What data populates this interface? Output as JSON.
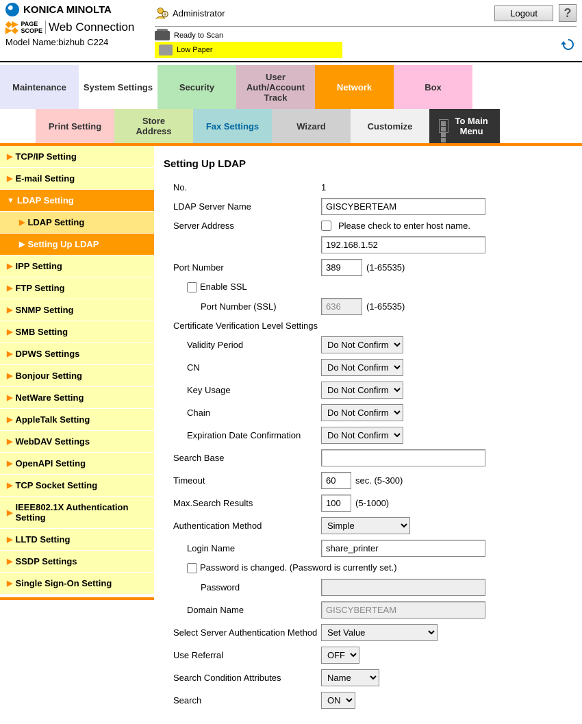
{
  "brand": "KONICA MINOLTA",
  "pagescope": {
    "small1": "PAGE",
    "small2": "SCOPE",
    "main": "Web Connection"
  },
  "model_label": "Model Name:",
  "model_value": "bizhub C224",
  "admin_user": "Administrator",
  "logout": "Logout",
  "help": "?",
  "status_ready": "Ready to Scan",
  "status_lowpaper": "Low Paper",
  "tabs1": {
    "maintenance": "Maintenance",
    "system": "System Settings",
    "security": "Security",
    "user": "User Auth/Account Track",
    "network": "Network",
    "box": "Box"
  },
  "tabs2": {
    "print": "Print Setting",
    "store": "Store Address",
    "fax": "Fax Settings",
    "wizard": "Wizard",
    "customize": "Customize",
    "tomain": "To Main Menu"
  },
  "sidebar": {
    "tcpip": "TCP/IP Setting",
    "email": "E-mail Setting",
    "ldap": "LDAP Setting",
    "ldap_sub1": "LDAP Setting",
    "ldap_sub2": "Setting Up LDAP",
    "ipp": "IPP Setting",
    "ftp": "FTP Setting",
    "snmp": "SNMP Setting",
    "smb": "SMB Setting",
    "dpws": "DPWS Settings",
    "bonjour": "Bonjour Setting",
    "netware": "NetWare Setting",
    "appletalk": "AppleTalk Setting",
    "webdav": "WebDAV Settings",
    "openapi": "OpenAPI Setting",
    "tcpsocket": "TCP Socket Setting",
    "ieee": "IEEE802.1X Authentication Setting",
    "lltd": "LLTD Setting",
    "ssdp": "SSDP Settings",
    "sso": "Single Sign-On Setting"
  },
  "page_title": "Setting Up LDAP",
  "form": {
    "no_label": "No.",
    "no_value": "1",
    "servername_label": "LDAP Server Name",
    "servername_value": "GISCYBERTEAM",
    "serveraddr_label": "Server Address",
    "serveraddr_check": "Please check to enter host name.",
    "serveraddr_value": "192.168.1.52",
    "port_label": "Port Number",
    "port_value": "389",
    "port_hint": "(1-65535)",
    "ssl_label": "Enable SSL",
    "sslport_label": "Port Number (SSL)",
    "sslport_value": "636",
    "sslport_hint": "(1-65535)",
    "certlevel_label": "Certificate Verification Level Settings",
    "validity_label": "Validity Period",
    "cn_label": "CN",
    "keyusage_label": "Key Usage",
    "chain_label": "Chain",
    "expdate_label": "Expiration Date Confirmation",
    "donotconfirm": "Do Not Confirm",
    "searchbase_label": "Search Base",
    "searchbase_value": "",
    "timeout_label": "Timeout",
    "timeout_value": "60",
    "timeout_hint": "sec. (5-300)",
    "maxresults_label": "Max.Search Results",
    "maxresults_value": "100",
    "maxresults_hint": "(5-1000)",
    "authmethod_label": "Authentication Method",
    "authmethod_value": "Simple",
    "loginname_label": "Login Name",
    "loginname_value": "share_printer",
    "pwchanged_label": "Password is changed.  (Password is currently set.)",
    "password_label": "Password",
    "domain_label": "Domain Name",
    "domain_value": "GISCYBERTEAM",
    "selectauth_label": "Select Server Authentication Method",
    "selectauth_value": "Set Value",
    "referral_label": "Use Referral",
    "referral_value": "OFF",
    "searchcond_label": "Search Condition Attributes",
    "searchcond_value": "Name",
    "search_label": "Search",
    "search_value": "ON"
  }
}
